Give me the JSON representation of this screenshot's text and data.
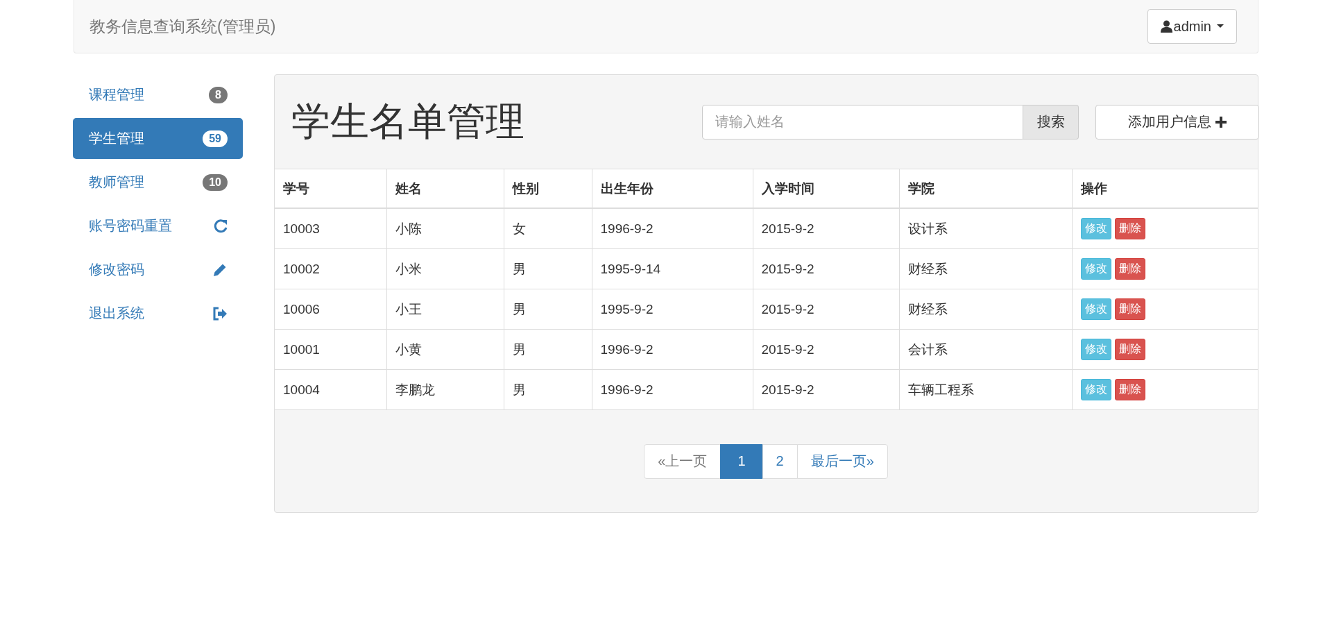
{
  "navbar": {
    "brand": "教务信息查询系统(管理员)",
    "user_menu": "admin"
  },
  "sidebar": {
    "items": [
      {
        "label": "课程管理",
        "kind": "badge",
        "badge": "8",
        "selected": false
      },
      {
        "label": "学生管理",
        "kind": "badge",
        "badge": "59",
        "selected": true
      },
      {
        "label": "教师管理",
        "kind": "badge",
        "badge": "10",
        "selected": false
      },
      {
        "label": "账号密码重置",
        "kind": "refresh",
        "selected": false
      },
      {
        "label": "修改密码",
        "kind": "pencil",
        "selected": false
      },
      {
        "label": "退出系统",
        "kind": "logout",
        "selected": false
      }
    ]
  },
  "panel": {
    "title": "学生名单管理",
    "search": {
      "placeholder": "请输入姓名",
      "button": "搜索"
    },
    "add_button": "添加用户信息"
  },
  "table": {
    "columns": [
      "学号",
      "姓名",
      "性别",
      "出生年份",
      "入学时间",
      "学院",
      "操作"
    ],
    "rows": [
      {
        "cells": [
          "10003",
          "小陈",
          "女",
          "1996-9-2",
          "2015-9-2",
          "设计系"
        ],
        "actions": [
          "修改",
          "删除"
        ]
      },
      {
        "cells": [
          "10002",
          "小米",
          "男",
          "1995-9-14",
          "2015-9-2",
          "财经系"
        ],
        "actions": [
          "修改",
          "删除"
        ]
      },
      {
        "cells": [
          "10006",
          "小王",
          "男",
          "1995-9-2",
          "2015-9-2",
          "财经系"
        ],
        "actions": [
          "修改",
          "删除"
        ]
      },
      {
        "cells": [
          "10001",
          "小黄",
          "男",
          "1996-9-2",
          "2015-9-2",
          "会计系"
        ],
        "actions": [
          "修改",
          "删除"
        ]
      },
      {
        "cells": [
          "10004",
          "李鹏龙",
          "男",
          "1996-9-2",
          "2015-9-2",
          "车辆工程系"
        ],
        "actions": [
          "修改",
          "删除"
        ]
      }
    ]
  },
  "pagination": [
    {
      "label": "«上一页",
      "selected": false,
      "disabled": true
    },
    {
      "label": "1",
      "selected": true,
      "disabled": false
    },
    {
      "label": "2",
      "selected": false,
      "disabled": false
    },
    {
      "label": "最后一页»",
      "selected": false,
      "disabled": false
    }
  ]
}
